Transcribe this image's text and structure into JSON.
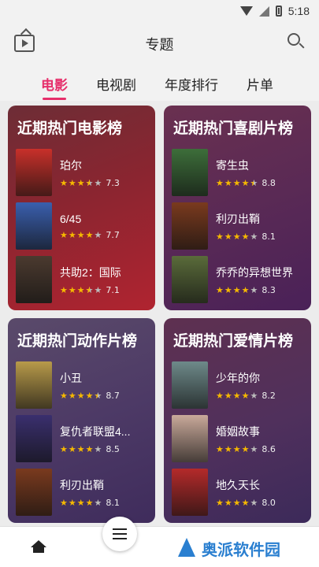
{
  "status_bar": {
    "time": "5:18"
  },
  "header": {
    "title": "专题"
  },
  "tabs": [
    {
      "label": "电影",
      "active": true
    },
    {
      "label": "电视剧",
      "active": false
    },
    {
      "label": "年度排行",
      "active": false
    },
    {
      "label": "片单",
      "active": false
    }
  ],
  "cards": [
    {
      "title": "近期热门电影榜",
      "theme": "red",
      "movies": [
        {
          "name": "珀尔",
          "rating": 7.3,
          "stars": 3.5,
          "poster_color": "#c8302a"
        },
        {
          "name": "6/45",
          "rating": 7.7,
          "stars": 4,
          "poster_color": "#3a5fae"
        },
        {
          "name": "共助2：国际",
          "rating": 7.1,
          "stars": 3.5,
          "poster_color": "#4b3a2f"
        }
      ]
    },
    {
      "title": "近期热门喜剧片榜",
      "theme": "purple1",
      "movies": [
        {
          "name": "寄生虫",
          "rating": 8.8,
          "stars": 4.5,
          "poster_color": "#3d6e3a"
        },
        {
          "name": "利刃出鞘",
          "rating": 8.1,
          "stars": 4,
          "poster_color": "#7a3a1e"
        },
        {
          "name": "乔乔的异想世界",
          "rating": 8.3,
          "stars": 4,
          "poster_color": "#5a6b3a"
        }
      ]
    },
    {
      "title": "近期热门动作片榜",
      "theme": "purple2",
      "movies": [
        {
          "name": "小丑",
          "rating": 8.7,
          "stars": 4.5,
          "poster_color": "#b89a4a"
        },
        {
          "name": "复仇者联盟4...",
          "rating": 8.5,
          "stars": 4,
          "poster_color": "#3a2f6e"
        },
        {
          "name": "利刃出鞘",
          "rating": 8.1,
          "stars": 4,
          "poster_color": "#7a3a1e"
        }
      ]
    },
    {
      "title": "近期热门爱情片榜",
      "theme": "purple3",
      "movies": [
        {
          "name": "少年的你",
          "rating": 8.2,
          "stars": 4,
          "poster_color": "#6e8a8a"
        },
        {
          "name": "婚姻故事",
          "rating": 8.6,
          "stars": 4,
          "poster_color": "#c9a99a"
        },
        {
          "name": "地久天长",
          "rating": 8.0,
          "stars": 4,
          "poster_color": "#b42a2a"
        }
      ]
    }
  ],
  "watermark": {
    "text": "奥派软件园"
  },
  "colors": {
    "accent": "#e62f6b",
    "star": "#f5b800"
  },
  "icons": {
    "tv": "tv-icon",
    "search": "search-icon",
    "home": "home-icon",
    "menu": "menu-icon"
  }
}
